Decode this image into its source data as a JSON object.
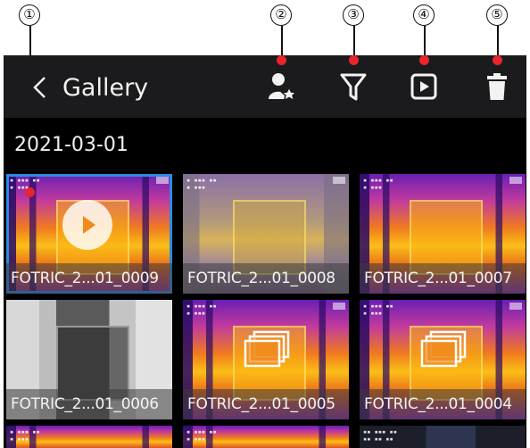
{
  "callouts": [
    "①",
    "②",
    "③",
    "④",
    "⑤"
  ],
  "header": {
    "title": "Gallery",
    "back_icon": "chevron-left-icon"
  },
  "actions": [
    {
      "name": "user-star-icon"
    },
    {
      "name": "filter-icon"
    },
    {
      "name": "play-icon"
    },
    {
      "name": "trash-icon"
    }
  ],
  "date_group": "2021-03-01",
  "tiles": [
    {
      "label": "FOTRIC_2...01_0009",
      "style": "thermal",
      "badge": "play",
      "selected": true
    },
    {
      "label": "FOTRIC_2...01_0008",
      "style": "thermal-pale",
      "badge": ""
    },
    {
      "label": "FOTRIC_2...01_0007",
      "style": "thermal",
      "badge": ""
    },
    {
      "label": "FOTRIC_2...01_0006",
      "style": "visual",
      "badge": ""
    },
    {
      "label": "FOTRIC_2...01_0005",
      "style": "thermal",
      "badge": "multi"
    },
    {
      "label": "FOTRIC_2...01_0004",
      "style": "thermal",
      "badge": "multi"
    }
  ],
  "colors": {
    "accent": "#2a8be6",
    "marker": "#e8252b",
    "header_bg": "#1b1b1d"
  }
}
